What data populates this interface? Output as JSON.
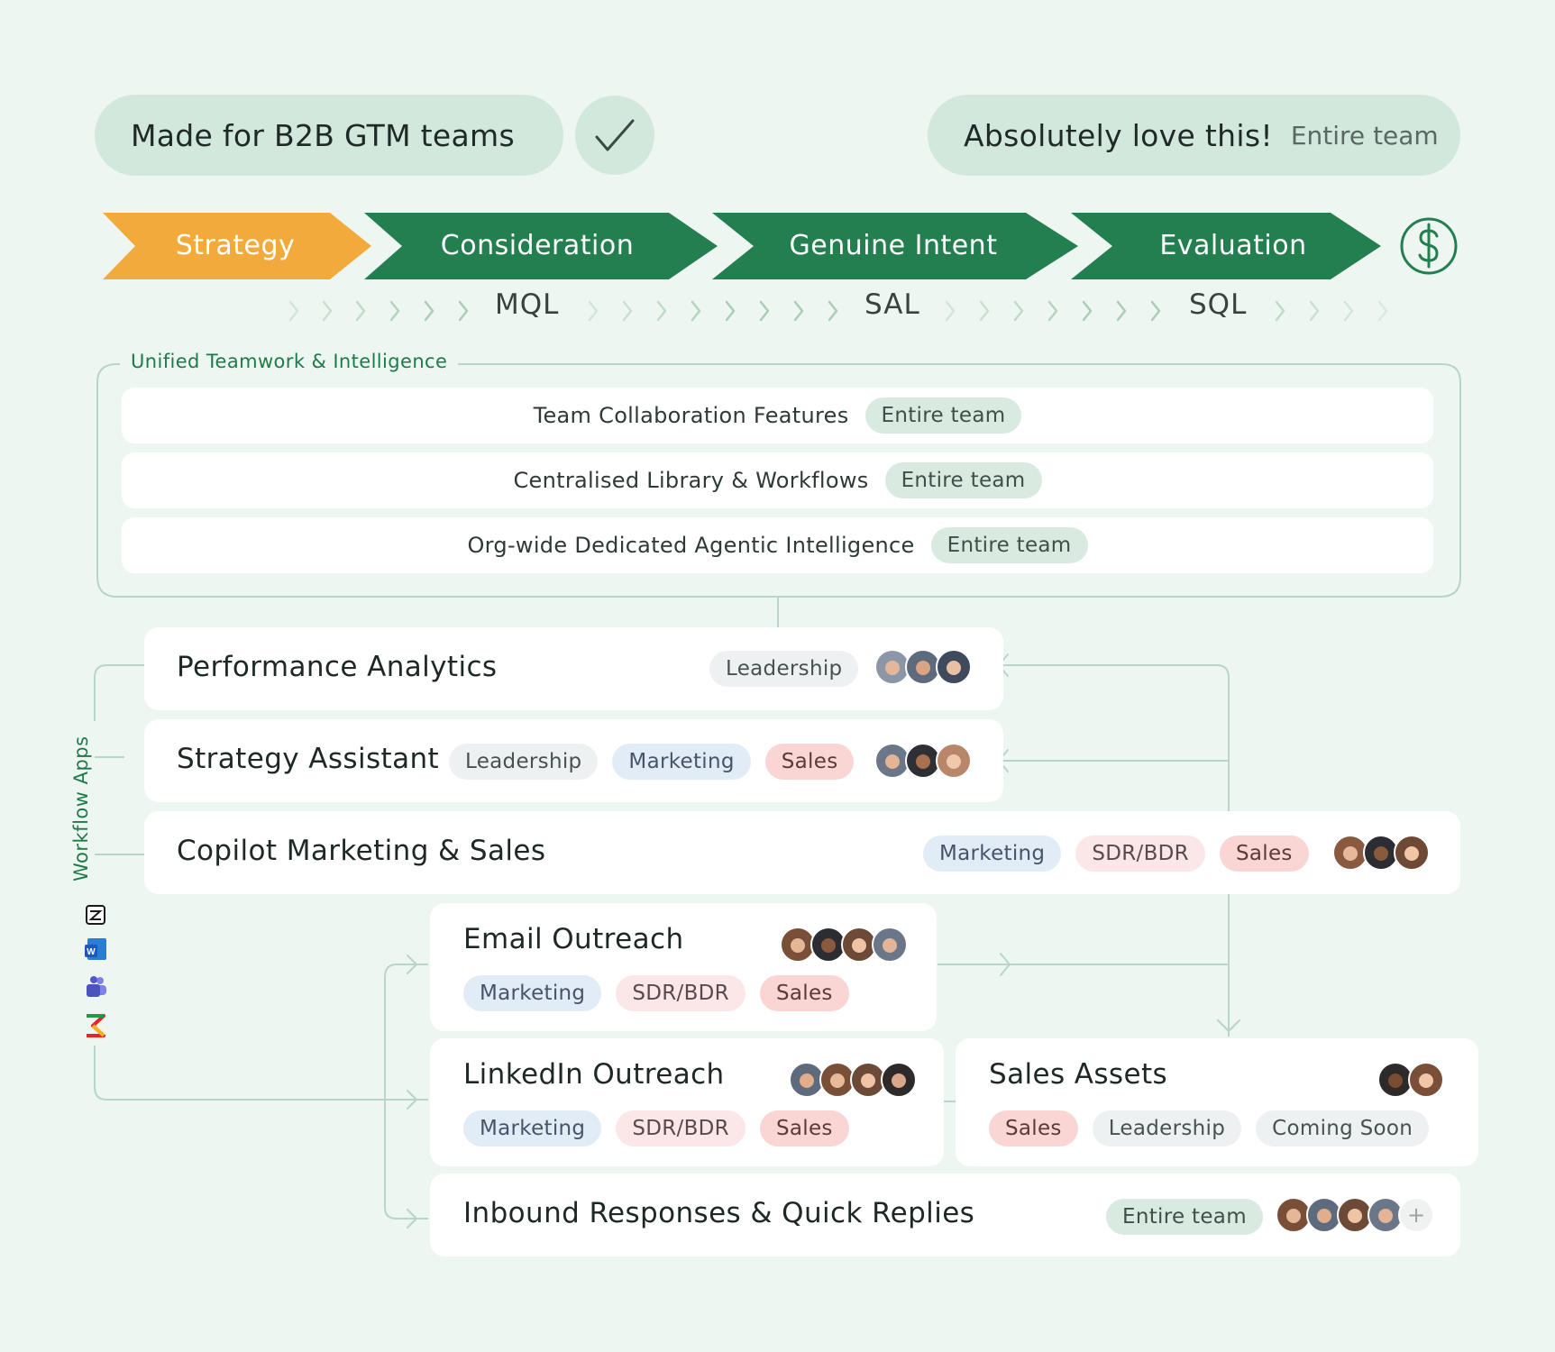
{
  "header": {
    "left_pill": "Made for B2B GTM teams",
    "right_pill": "Absolutely love this!",
    "right_pill_tag": "Entire team",
    "check_icon": "check-icon",
    "dollar_icon": "dollar-icon"
  },
  "stages": [
    {
      "label": "Strategy",
      "color": "#f2aa3a"
    },
    {
      "label": "Consideration",
      "color": "#237f4f"
    },
    {
      "label": "Genuine Intent",
      "color": "#237f4f"
    },
    {
      "label": "Evaluation",
      "color": "#237f4f"
    }
  ],
  "phases": [
    "MQL",
    "SAL",
    "SQL"
  ],
  "unified": {
    "title": "Unified Teamwork & Intelligence",
    "rows": [
      {
        "label": "Team Collaboration Features",
        "tag": "Entire team"
      },
      {
        "label": "Centralised Library & Workflows",
        "tag": "Entire team"
      },
      {
        "label": "Org-wide Dedicated Agentic Intelligence",
        "tag": "Entire team"
      }
    ]
  },
  "workflow": {
    "title": "Workflow Apps",
    "icons": [
      "zendesk-icon",
      "word-icon",
      "teams-icon",
      "zoho-icon"
    ]
  },
  "apps": {
    "performance": {
      "title": "Performance Analytics",
      "tags": [
        "Leadership"
      ]
    },
    "strategy": {
      "title": "Strategy Assistant",
      "tags": [
        "Leadership",
        "Marketing",
        "Sales"
      ]
    },
    "copilot": {
      "title": "Copilot Marketing & Sales",
      "tags": [
        "Marketing",
        "SDR/BDR",
        "Sales"
      ]
    },
    "email": {
      "title": "Email Outreach",
      "tags": [
        "Marketing",
        "SDR/BDR",
        "Sales"
      ]
    },
    "linkedin": {
      "title": "LinkedIn Outreach",
      "tags": [
        "Marketing",
        "SDR/BDR",
        "Sales"
      ]
    },
    "assets": {
      "title": "Sales Assets",
      "tags": [
        "Sales",
        "Leadership",
        "Coming Soon"
      ]
    },
    "inbound": {
      "title": "Inbound Responses & Quick Replies",
      "tags": [
        "Entire team"
      ],
      "plus": "+"
    }
  }
}
